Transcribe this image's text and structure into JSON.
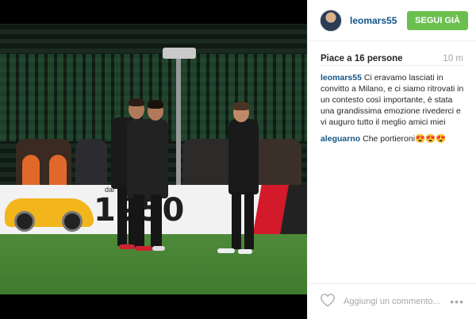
{
  "header": {
    "username": "leomars55",
    "follow_label": "SEGUI GIÀ"
  },
  "stats": {
    "likes": "Piace a 16 persone",
    "time": "10 m"
  },
  "caption": {
    "username": "leomars55",
    "text": "Ci eravamo lasciati in convitto a Milano, e ci siamo ritrovati in un contesto così importante, è stata una grandissima emozione rivederci e vi auguro tutto il meglio amici miei"
  },
  "comments": [
    {
      "username": "aleguarno",
      "text": "Che portieroni😍😍😍"
    }
  ],
  "footer": {
    "comment_placeholder": "Aggiungi un commento...",
    "more_glyph": "•••"
  },
  "photo": {
    "ad_number": "1950",
    "ad_tagline": "dal"
  },
  "colors": {
    "username": "#125688",
    "follow_button": "#6bbf4e"
  },
  "icons": [
    "heart-icon",
    "more-options-icon"
  ]
}
